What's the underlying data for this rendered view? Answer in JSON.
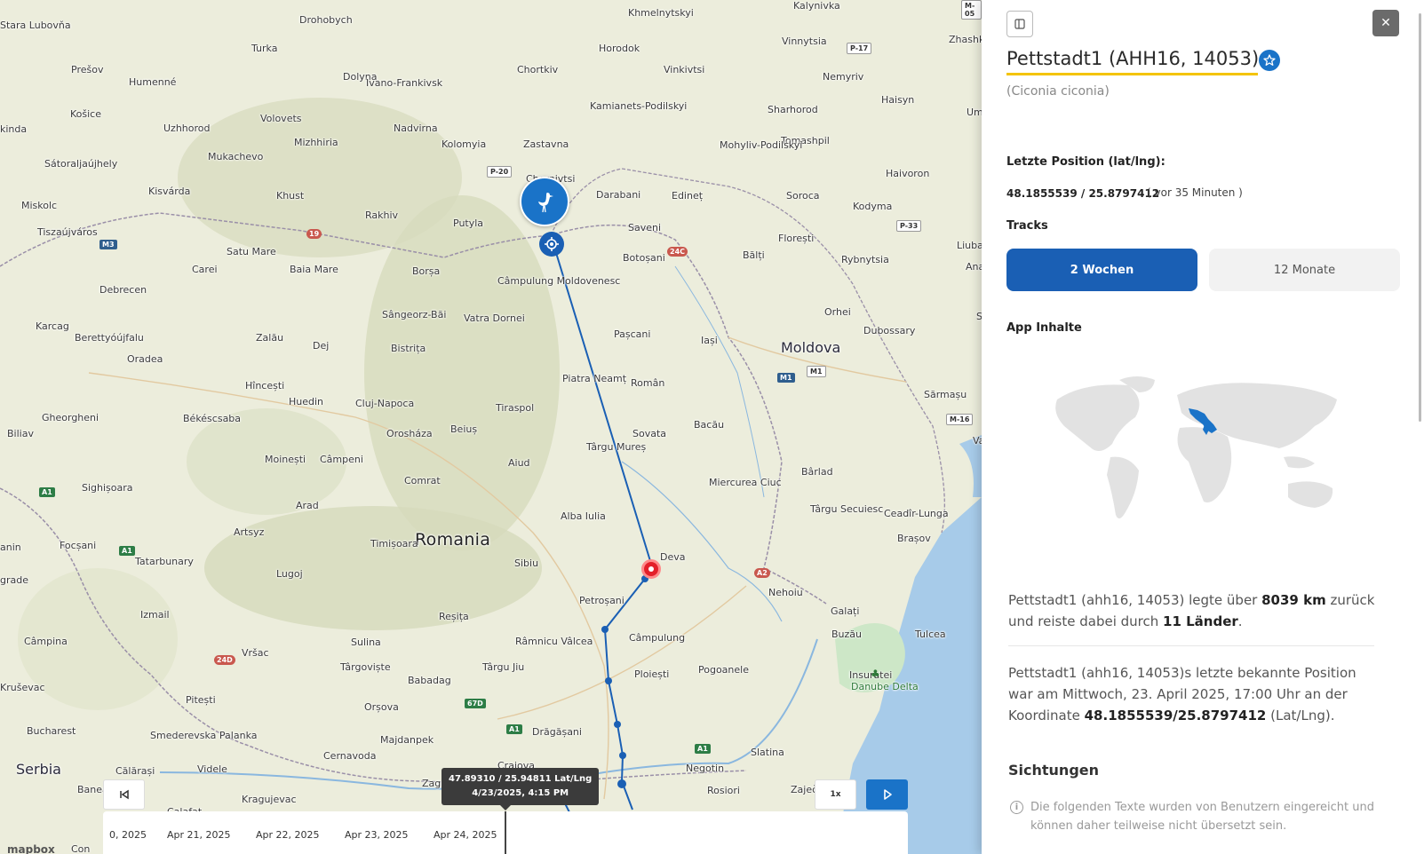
{
  "map": {
    "countries": [
      {
        "key": "romania",
        "label": "Romania"
      },
      {
        "key": "moldova",
        "label": "Moldova"
      },
      {
        "key": "serbia",
        "label": "Serbia"
      }
    ],
    "cities": [
      "Drohobych",
      "Khmelnytskyi",
      "Kalynivka",
      "Zhashkiv",
      "Stara Lubovňa",
      "Turka",
      "Horodok",
      "Vinnytsia",
      "Prešov",
      "Humenné",
      "Dolyna",
      "Ivano-Frankivsk",
      "Chortkiv",
      "Vinkivtsi",
      "Nemyriv",
      "Haisyn",
      "Uma",
      "Košice",
      "Volovets",
      "Kamianets-Podilskyi",
      "Sharhorod",
      "Uzhhorod",
      "Nadvirna",
      "Tomashpil",
      "Kolomyia",
      "Zastavna",
      "Mohyliv-Podilskyi",
      "Sátoraljaújhely",
      "Mizhhiria",
      "Mukachevo",
      "Haivoron",
      "Chernivtsi",
      "Kisvárda",
      "Khust",
      "Darabani",
      "Edineț",
      "Soroca",
      "Kodyma",
      "Miskolc",
      "Rakhiv",
      "Putyla",
      "Saveni",
      "Florești",
      "Tiszaújváros",
      "Liubas",
      "Satu Mare",
      "Botoșani",
      "Bălți",
      "Rybnytsia",
      "Carei",
      "Baia Mare",
      "Borșa",
      "Câmpulung Moldovenesc",
      "Ananiv",
      "Debrecen",
      "Karcag",
      "Sângeorz-Băi",
      "Vatra Dornei",
      "Pașcani",
      "Orhei",
      "Berettyóújfalu",
      "Zalău",
      "Dej",
      "Bistrița",
      "Iași",
      "Dubossary",
      "Shyriaie",
      "Oradea",
      "Piatra Neamț",
      "Român",
      "Hîncești",
      "Huedin",
      "Cluj-Napoca",
      "Sărmașu",
      "Tiraspol",
      "Gheorgheni",
      "Békéscsaba",
      "Beiuș",
      "Sovata",
      "Bacău",
      "Vaslui",
      "Biliav",
      "Orosháza",
      "Târgu Mureș",
      "Moinești",
      "Câmpeni",
      "Aiud",
      "Miercurea Ciuc",
      "Bârlad",
      "Comrat",
      "Sighișoara",
      "Arad",
      "Alba Iulia",
      "Târgu Secuiesc",
      "Ceadîr-Lunga",
      "Artsyz",
      "Deva",
      "Focșani",
      "Timișoara",
      "Sibiu",
      "Brașov",
      "Tatarbunary",
      "Lugoj",
      "Petroșani",
      "Nehoiu",
      "Galați",
      "Izmail",
      "Reșița",
      "Câmpulung",
      "Buzău",
      "Tulcea",
      "Sulina",
      "Râmnicu Vâlcea",
      "Câmpina",
      "Vršac",
      "Târgu Jiu",
      "Târgoviște",
      "Ploiești",
      "Pogoanele",
      "Insuratei",
      "Babadag",
      "Pitești",
      "Orșova",
      "Drăgășani",
      "Bucharest",
      "Smederevska Palanka",
      "Majdanpek",
      "Slatina",
      "Cernavoda",
      "Craiova",
      "Videle",
      "Negotin",
      "Călărași",
      "Zagubica",
      "Rosiori",
      "Baneasa",
      "Kragujevac",
      "Calafat",
      "Zaječar",
      "Con",
      "Kruševac",
      "grade",
      "anin",
      "kinda",
      "ņave"
    ],
    "park_label": "Danube Delta",
    "shields": [
      "M-05",
      "P-17",
      "P-20",
      "19",
      "M3",
      "24C",
      "P-33",
      "M1",
      "M1",
      "M-16",
      "A1",
      "A1",
      "24D",
      "67D",
      "A1",
      "A1",
      "A2"
    ],
    "tooltip": {
      "coords": "47.89310 / 25.94811 Lat/Lng",
      "datetime": "4/23/2025, 4:15 PM"
    },
    "speed_label": "1x",
    "timeline": {
      "ticks": [
        "0, 2025",
        "Apr 21, 2025",
        "Apr 22, 2025",
        "Apr 23, 2025",
        "Apr 24, 2025"
      ]
    },
    "logo_text": "mapbox",
    "icons": [
      "stork-icon",
      "locate-target-icon",
      "skip-back-icon",
      "play-icon"
    ],
    "track_color": "#1a5fb4",
    "marker_color": "#1a73c8",
    "alert_color": "#e3202a"
  },
  "panel": {
    "title": "Pettstadt1 (AHH16, 14053)",
    "subtitle": "(Ciconia ciconia)",
    "position_label": "Letzte Position (lat/lng):",
    "position_value": "48.1855539 / 25.8797412",
    "position_ago": "( vor 35 Minuten )",
    "tracks_label": "Tracks",
    "tabs": [
      {
        "label": "2 Wochen",
        "active": true
      },
      {
        "label": "12 Monate",
        "active": false
      }
    ],
    "app_content_label": "App Inhalte",
    "summary": {
      "prefix": "Pettstadt1 (ahh16, 14053) legte über ",
      "distance": "8039 km",
      "middle": " zurück und reiste dabei durch ",
      "countries": "11 Länder",
      "suffix": "."
    },
    "last_known": {
      "prefix": "Pettstadt1 (ahh16, 14053)s letzte bekannte Position war am Mittwoch, 23. April 2025, 17:00 Uhr an der Koordinate ",
      "coords": "48.1855539/25.8797412",
      "suffix": " (Lat/Lng)."
    },
    "sightings_title": "Sichtungen",
    "sightings_note": "Die folgenden Texte wurden von Benutzern eingereicht und können daher teilweise nicht übersetzt sein.",
    "close_symbol": "✕",
    "accent_color": "#1a5fb4",
    "highlight_color": "#f4c400"
  }
}
